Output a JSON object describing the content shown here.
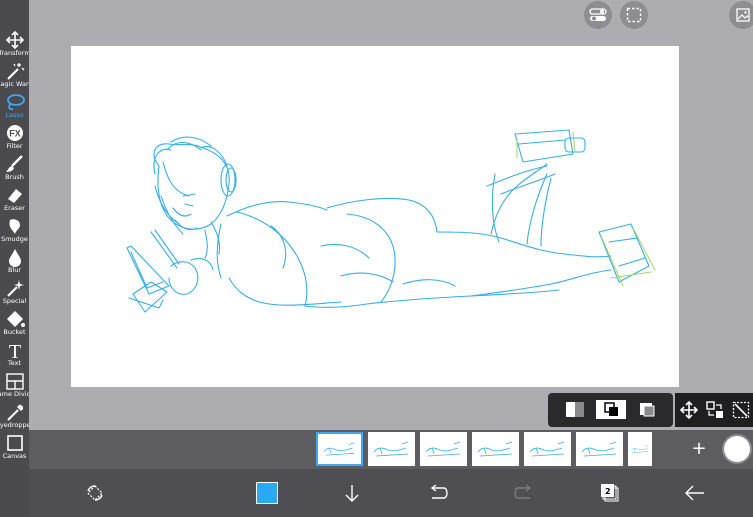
{
  "toolbar": {
    "tools": [
      {
        "id": "transform",
        "label": "Transform",
        "icon": "transform-arrows-icon"
      },
      {
        "id": "magic-wand",
        "label": "Magic Wand",
        "icon": "magic-wand-icon"
      },
      {
        "id": "lasso",
        "label": "Lasso",
        "icon": "lasso-icon",
        "active": true
      },
      {
        "id": "filter",
        "label": "Filter",
        "icon": "fx-icon"
      },
      {
        "id": "brush",
        "label": "Brush",
        "icon": "brush-icon"
      },
      {
        "id": "eraser",
        "label": "Eraser",
        "icon": "eraser-icon"
      },
      {
        "id": "smudge",
        "label": "Smudge",
        "icon": "smudge-icon"
      },
      {
        "id": "blur",
        "label": "Blur",
        "icon": "drop-icon"
      },
      {
        "id": "special",
        "label": "Special",
        "icon": "sparkle-icon"
      },
      {
        "id": "bucket",
        "label": "Bucket",
        "icon": "bucket-icon"
      },
      {
        "id": "text",
        "label": "Text",
        "icon": "text-icon"
      },
      {
        "id": "frame-divider",
        "label": "Frame Divider",
        "icon": "frame-divider-icon"
      },
      {
        "id": "eyedropper",
        "label": "Eyedropper",
        "icon": "eyedropper-icon"
      },
      {
        "id": "canvas",
        "label": "Canvas",
        "icon": "canvas-icon"
      }
    ],
    "accent_color": "#3ea8f5"
  },
  "top_buttons": [
    {
      "name": "toggle-view-button",
      "icon": "toggle-icon"
    },
    {
      "name": "selection-button",
      "icon": "dashed-square-icon"
    },
    {
      "name": "gallery-button",
      "icon": "image-icon"
    }
  ],
  "frames": {
    "count": 7,
    "selected_index": 0,
    "add_label": "+"
  },
  "bottom_bar": {
    "brush_color": "#29a9f2",
    "layer_count": "2"
  },
  "colors": {
    "sketch": "#37aee6",
    "sketch_green": "#a6d36b",
    "canvas_bg": "#ffffff",
    "workspace_bg": "#adadb1"
  }
}
